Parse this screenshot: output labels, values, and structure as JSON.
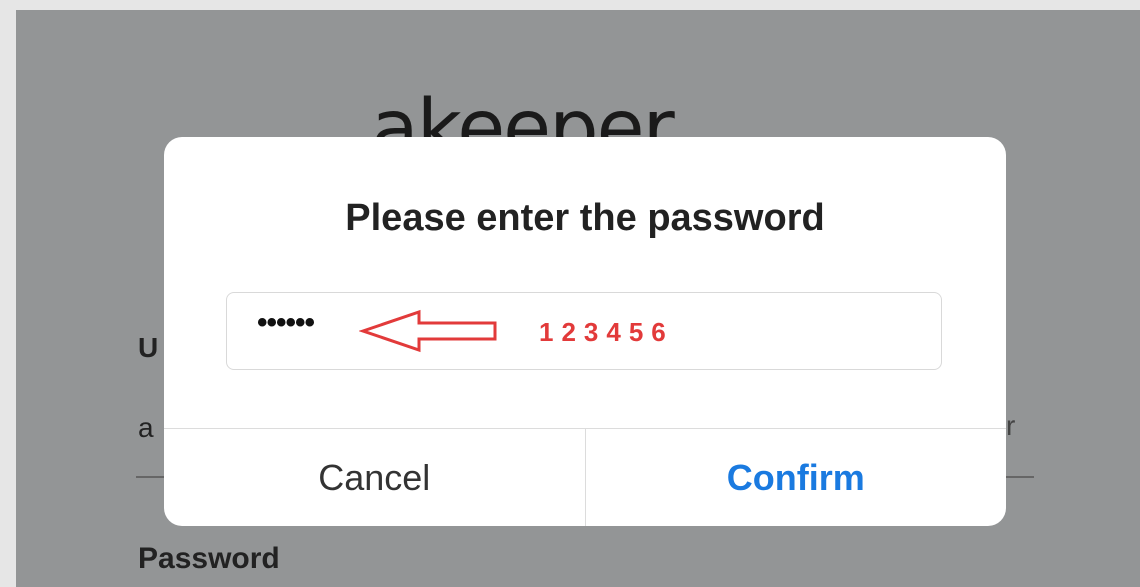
{
  "background": {
    "logo_text": "akeeper",
    "user_label": "U",
    "user_value": "a",
    "tick": "r",
    "password_label": "Password"
  },
  "dialog": {
    "title": "Please enter the password",
    "password_masked": "••••••",
    "password_hint": "123456",
    "cancel_label": "Cancel",
    "confirm_label": "Confirm"
  },
  "colors": {
    "overlay": "#939596",
    "dialog_bg": "#ffffff",
    "confirm": "#1a7ae0",
    "annotation": "#e23a3a"
  },
  "icons": {
    "arrow": "left-arrow-icon"
  }
}
